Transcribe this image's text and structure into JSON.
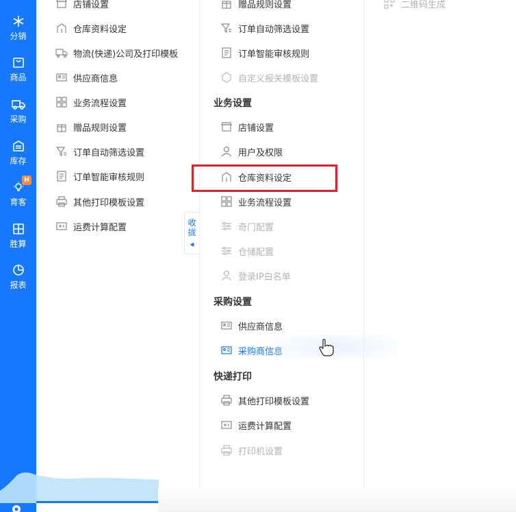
{
  "rail": {
    "items": [
      {
        "label": "分销",
        "icon": "snowflake-icon"
      },
      {
        "label": "商品",
        "icon": "bag-icon"
      },
      {
        "label": "采购",
        "icon": "truck-icon"
      },
      {
        "label": "库存",
        "icon": "warehouse-icon"
      },
      {
        "label": "育客",
        "icon": "bulb-icon",
        "badge": "H"
      },
      {
        "label": "胜算",
        "icon": "calculator-icon"
      },
      {
        "label": "报表",
        "icon": "pie-chart-icon"
      }
    ]
  },
  "col1": {
    "items": [
      {
        "label": "店铺设置"
      },
      {
        "label": "仓库资料设定"
      },
      {
        "label": "物流(快递)公司及打印模板"
      },
      {
        "label": "供应商信息"
      },
      {
        "label": "业务流程设置"
      },
      {
        "label": "赠品规则设置"
      },
      {
        "label": "订单自动筛选设置"
      },
      {
        "label": "订单智能审核规则"
      },
      {
        "label": "其他打印模板设置"
      },
      {
        "label": "运费计算配置"
      }
    ]
  },
  "collapse": {
    "line1": "收",
    "line2": "拢",
    "arrow": "◀"
  },
  "col2": {
    "top_items": [
      {
        "label": "赠品规则设置"
      },
      {
        "label": "订单自动筛选设置"
      },
      {
        "label": "订单智能审核规则"
      },
      {
        "label": "自定义报关模板设置"
      }
    ],
    "sections": [
      {
        "title": "业务设置",
        "items": [
          {
            "label": "店铺设置"
          },
          {
            "label": "用户及权限"
          },
          {
            "label": "仓库资料设定"
          },
          {
            "label": "业务流程设置"
          },
          {
            "label": "奇门配置"
          },
          {
            "label": "仓储配置"
          },
          {
            "label": "登录IP白名单"
          }
        ]
      },
      {
        "title": "采购设置",
        "items": [
          {
            "label": "供应商信息"
          },
          {
            "label": "采购商信息"
          }
        ]
      },
      {
        "title": "快递打印",
        "items": [
          {
            "label": "其他打印模板设置"
          },
          {
            "label": "运费计算配置"
          },
          {
            "label": "打印机设置"
          }
        ]
      }
    ]
  },
  "col3": {
    "items": [
      {
        "label": "二维码生成"
      }
    ]
  },
  "colors": {
    "primary": "#1677ff",
    "highlight": "#e0202a",
    "disabled": "#b3b3b3"
  }
}
